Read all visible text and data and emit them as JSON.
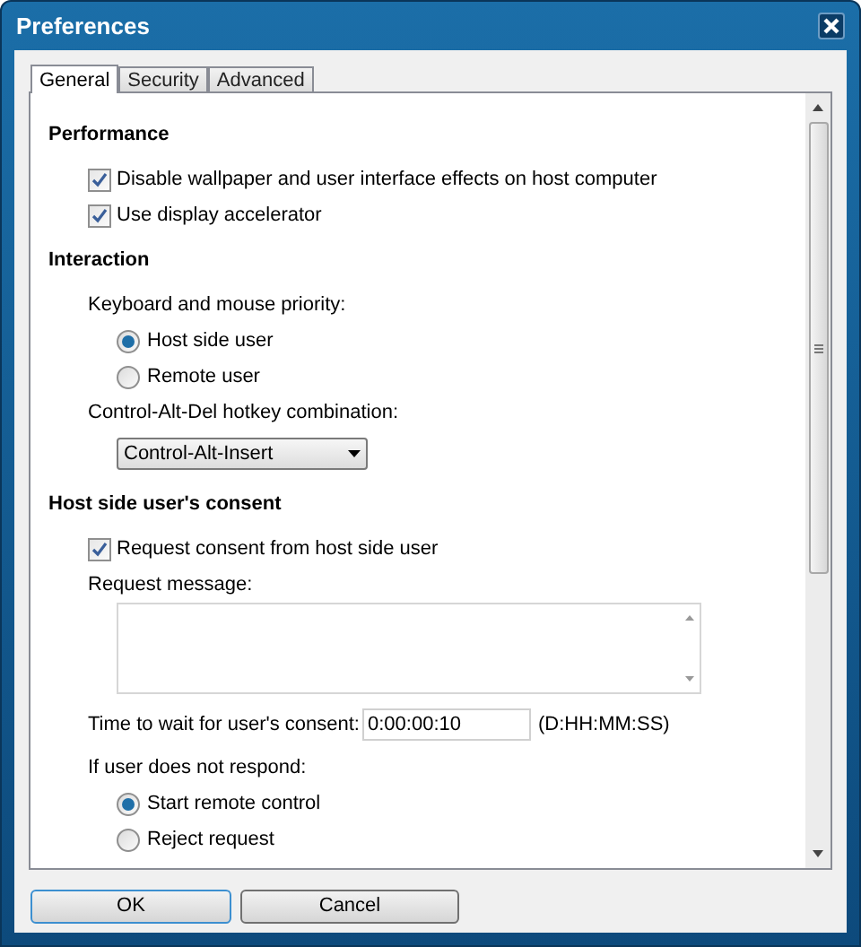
{
  "window": {
    "title": "Preferences"
  },
  "tabs": [
    {
      "label": "General",
      "selected": true
    },
    {
      "label": "Security",
      "selected": false
    },
    {
      "label": "Advanced",
      "selected": false
    }
  ],
  "sections": [
    {
      "heading": "Performance",
      "items": [
        {
          "kind": "checkbox",
          "label": "Disable wallpaper and user interface effects on host computer",
          "checked": true
        },
        {
          "kind": "checkbox",
          "label": "Use display accelerator",
          "checked": true
        }
      ]
    },
    {
      "heading": "Interaction",
      "items": [
        {
          "kind": "label",
          "text": "Keyboard and mouse priority:"
        },
        {
          "kind": "radio",
          "label": "Host side user",
          "selected": true
        },
        {
          "kind": "radio",
          "label": "Remote user",
          "selected": false
        },
        {
          "kind": "label",
          "text": "Control-Alt-Del hotkey combination:"
        },
        {
          "kind": "dropdown",
          "value": "Control-Alt-Insert"
        }
      ]
    },
    {
      "heading": "Host side user's consent",
      "items": [
        {
          "kind": "checkbox",
          "label": "Request consent from host side user",
          "checked": true
        },
        {
          "kind": "label",
          "text": "Request message:"
        },
        {
          "kind": "textarea"
        },
        {
          "kind": "time",
          "label": "Time to wait for user's consent:",
          "value": "0:00:00:10",
          "hint": "(D:HH:MM:SS)"
        },
        {
          "kind": "label",
          "text": "If user does not respond:"
        },
        {
          "kind": "radio",
          "label": "Start remote control",
          "selected": true
        },
        {
          "kind": "radio",
          "label": "Reject request",
          "selected": false
        }
      ]
    }
  ],
  "buttons": [
    {
      "label": "OK",
      "default": true
    },
    {
      "label": "Cancel",
      "default": false
    }
  ]
}
